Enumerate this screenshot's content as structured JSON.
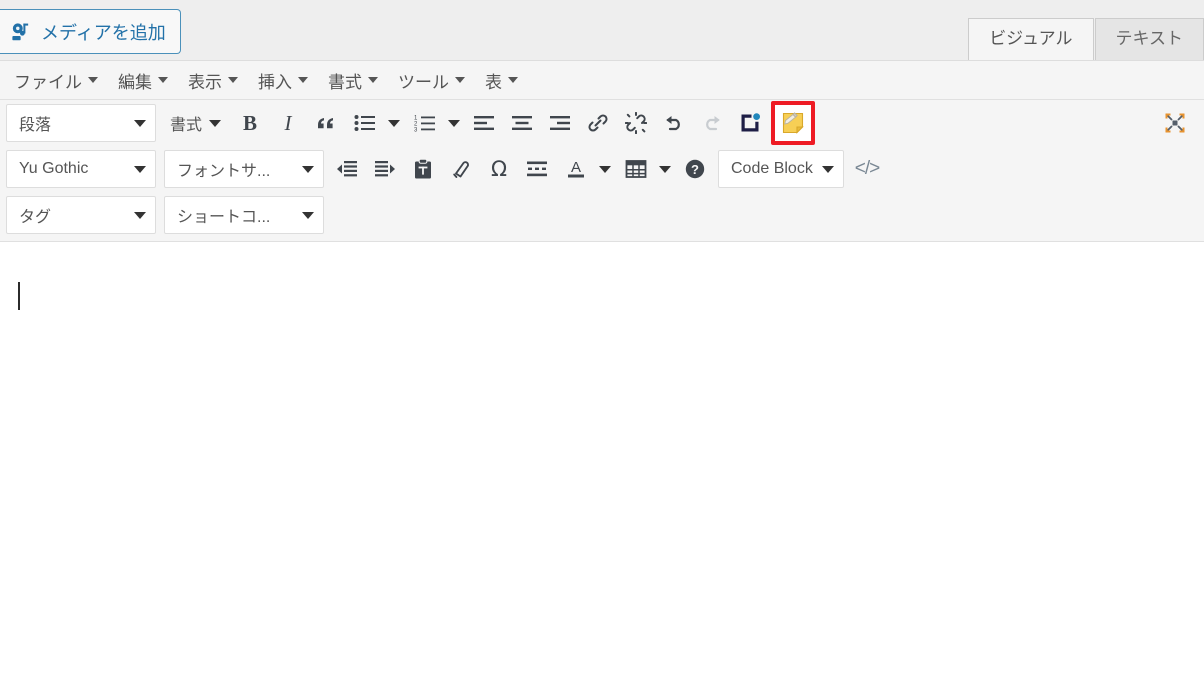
{
  "header": {
    "add_media_label": "メディアを追加",
    "add_media_icon": "media-add-icon",
    "tabs": [
      {
        "label": "ビジュアル",
        "name": "tab-visual",
        "active": true
      },
      {
        "label": "テキスト",
        "name": "tab-text",
        "active": false
      }
    ]
  },
  "menubar": {
    "items": [
      {
        "label": "ファイル",
        "name": "menu-file"
      },
      {
        "label": "編集",
        "name": "menu-edit"
      },
      {
        "label": "表示",
        "name": "menu-view"
      },
      {
        "label": "挿入",
        "name": "menu-insert"
      },
      {
        "label": "書式",
        "name": "menu-format"
      },
      {
        "label": "ツール",
        "name": "menu-tools"
      },
      {
        "label": "表",
        "name": "menu-table"
      }
    ]
  },
  "toolbar_row1": {
    "paragraph_select": "段落",
    "format_button": "書式",
    "bold": "B",
    "italic": "I",
    "blockquote": "“",
    "icons": [
      "bullet-list-icon",
      "numbered-list-icon",
      "align-left-icon",
      "align-center-icon",
      "align-right-icon",
      "link-icon",
      "unlink-icon",
      "undo-icon",
      "redo-icon",
      "cocoon-block-icon",
      "sticky-note-edit-icon",
      "fullscreen-icon"
    ]
  },
  "toolbar_row2": {
    "font_select": "Yu Gothic",
    "fontsize_select": "フォントサ...",
    "codeblock_select": "Code Block",
    "help_label": "?",
    "icons": [
      "indent-decrease-icon",
      "indent-increase-icon",
      "paste-as-text-icon",
      "clear-formatting-icon",
      "special-character-icon",
      "horizontal-rule-icon",
      "text-color-icon",
      "table-icon",
      "help-icon",
      "source-code-icon"
    ]
  },
  "toolbar_row3": {
    "tag_select": "タグ",
    "shortcode_select": "ショートコ..."
  },
  "content": {
    "body_text": "",
    "caret_visible": true
  },
  "colors": {
    "header_bg": "#eeeeee",
    "toolbar_bg": "#f5f5f5",
    "link_blue": "#2271a8",
    "icon_dark": "#40464d",
    "icon_disabled": "#c8ccd0",
    "highlight_red": "#ee1b24",
    "sticky_yellow": "#f5c842",
    "cocoon_navy": "#1e1e46",
    "cocoon_dot_blue": "#2187bb"
  }
}
